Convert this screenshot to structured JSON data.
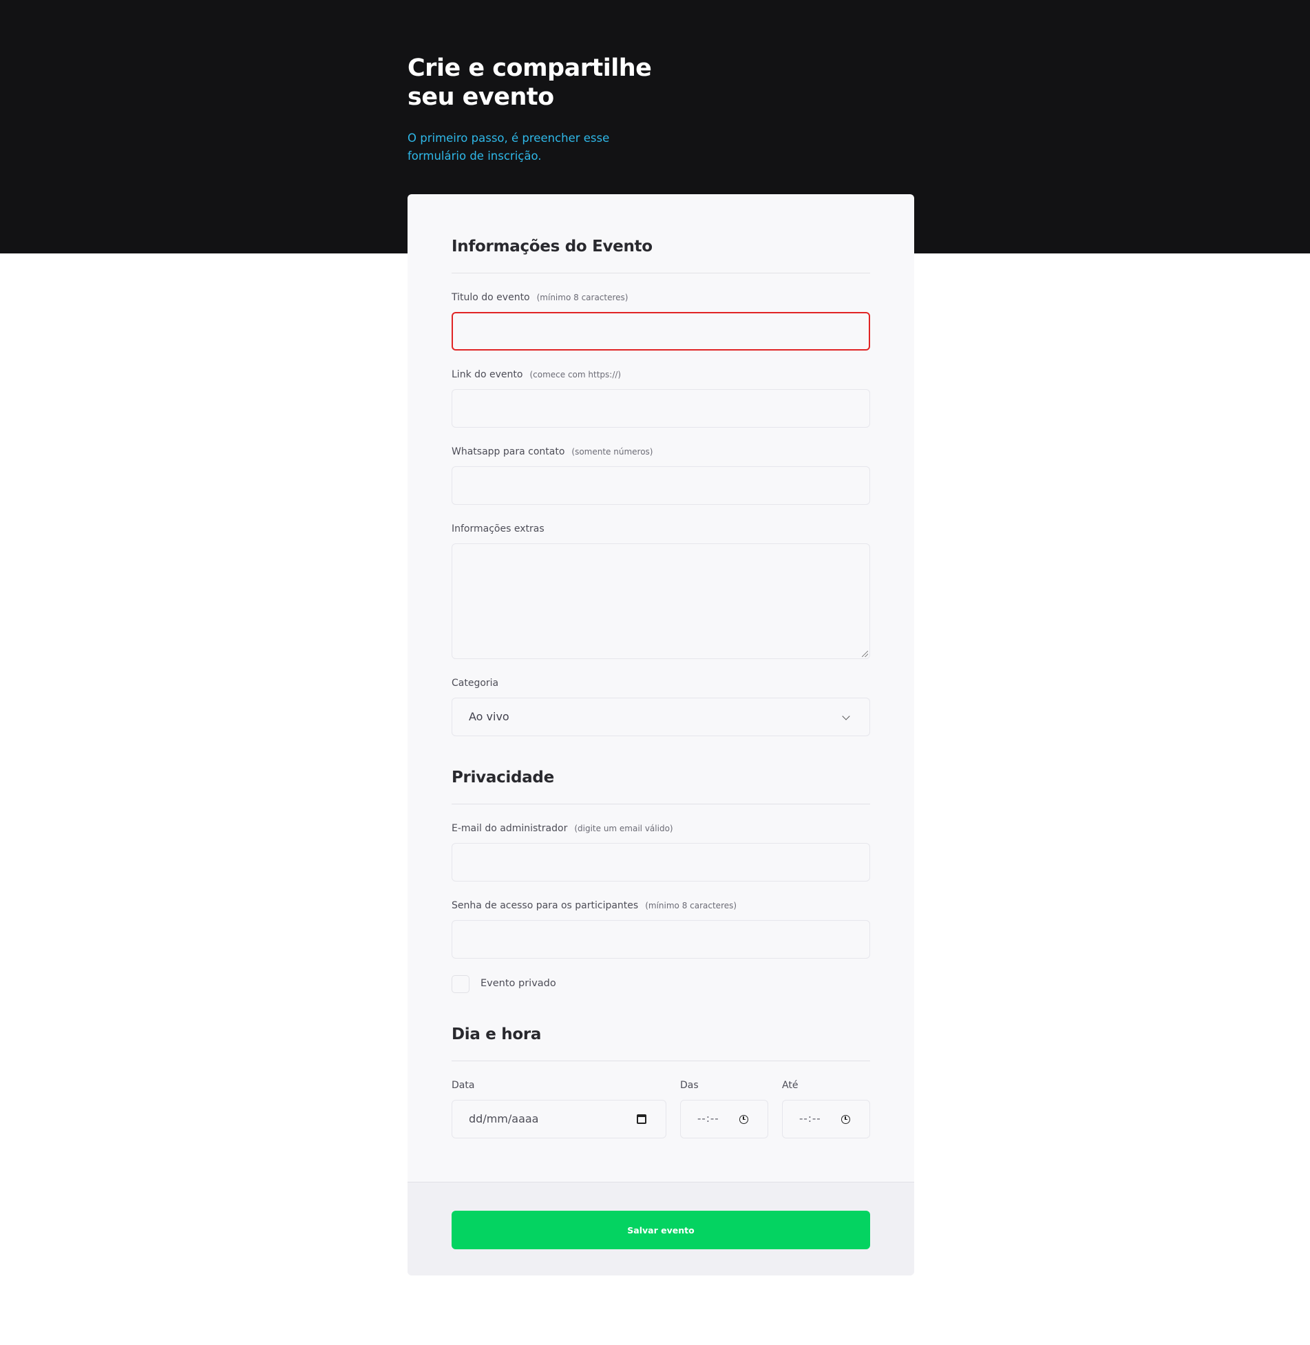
{
  "hero": {
    "title": "Crie e compartilhe seu evento",
    "subtitle": "O primeiro passo, é preencher esse formulário de inscrição."
  },
  "form": {
    "event_section": {
      "title": "Informações do Evento",
      "fields": {
        "title": {
          "label": "Titulo do evento",
          "hint": "(mínimo 8 caracteres)",
          "value": ""
        },
        "link": {
          "label": "Link do evento",
          "hint": "(comece com https://)",
          "value": ""
        },
        "whatsapp": {
          "label": "Whatsapp para contato",
          "hint": "(somente números)",
          "value": ""
        },
        "extras": {
          "label": "Informações extras",
          "value": ""
        },
        "category": {
          "label": "Categoria",
          "selected": "Ao vivo"
        }
      }
    },
    "privacy_section": {
      "title": "Privacidade",
      "fields": {
        "admin_email": {
          "label": "E-mail do administrador",
          "hint": "(digite um email válido)",
          "value": ""
        },
        "password": {
          "label": "Senha de acesso para os participantes",
          "hint": "(mínimo 8 caracteres)",
          "value": ""
        },
        "private": {
          "label": "Evento privado",
          "checked": false
        }
      }
    },
    "datetime_section": {
      "title": "Dia e hora",
      "fields": {
        "date": {
          "label": "Data",
          "placeholder": "dd/mm/aaaa"
        },
        "from": {
          "label": "Das",
          "placeholder": "--:--"
        },
        "to": {
          "label": "Até",
          "placeholder": "--:--"
        }
      }
    },
    "submit_label": "Salvar evento"
  },
  "colors": {
    "hero_bg": "#121214",
    "accent_blue": "#2fb8e8",
    "error_border": "#e02424",
    "submit_green": "#04d361"
  }
}
